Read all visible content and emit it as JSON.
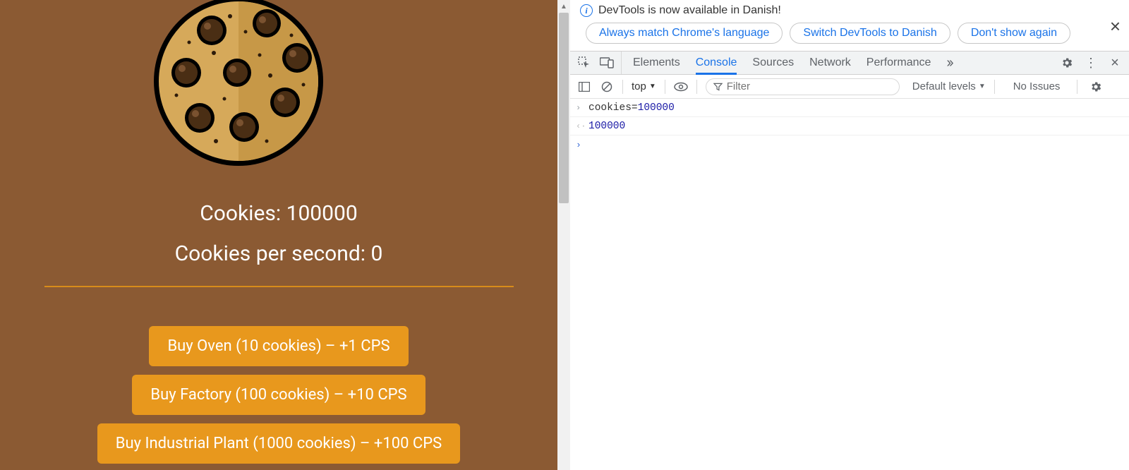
{
  "game": {
    "cookies_label": "Cookies: 100000",
    "cps_label": "Cookies per second: 0",
    "buttons": {
      "oven": "Buy Oven (10 cookies) – +1 CPS",
      "factory": "Buy Factory (100 cookies) – +10 CPS",
      "plant": "Buy Industrial Plant (1000 cookies) – +100 CPS"
    },
    "colors": {
      "bg": "#8b5a33",
      "accent": "#e8981d",
      "divider": "#d88c1a"
    }
  },
  "devtools": {
    "info": {
      "message": "DevTools is now available in Danish!",
      "options": {
        "match": "Always match Chrome's language",
        "switch": "Switch DevTools to Danish",
        "dismiss": "Don't show again"
      }
    },
    "tabs": {
      "elements": "Elements",
      "console": "Console",
      "sources": "Sources",
      "network": "Network",
      "performance": "Performance"
    },
    "toolbar": {
      "context": "top",
      "filter_placeholder": "Filter",
      "levels": "Default levels",
      "issues": "No Issues"
    },
    "console": {
      "input_var": "cookies",
      "input_op": "=",
      "input_val": "100000",
      "output_val": "100000"
    }
  }
}
